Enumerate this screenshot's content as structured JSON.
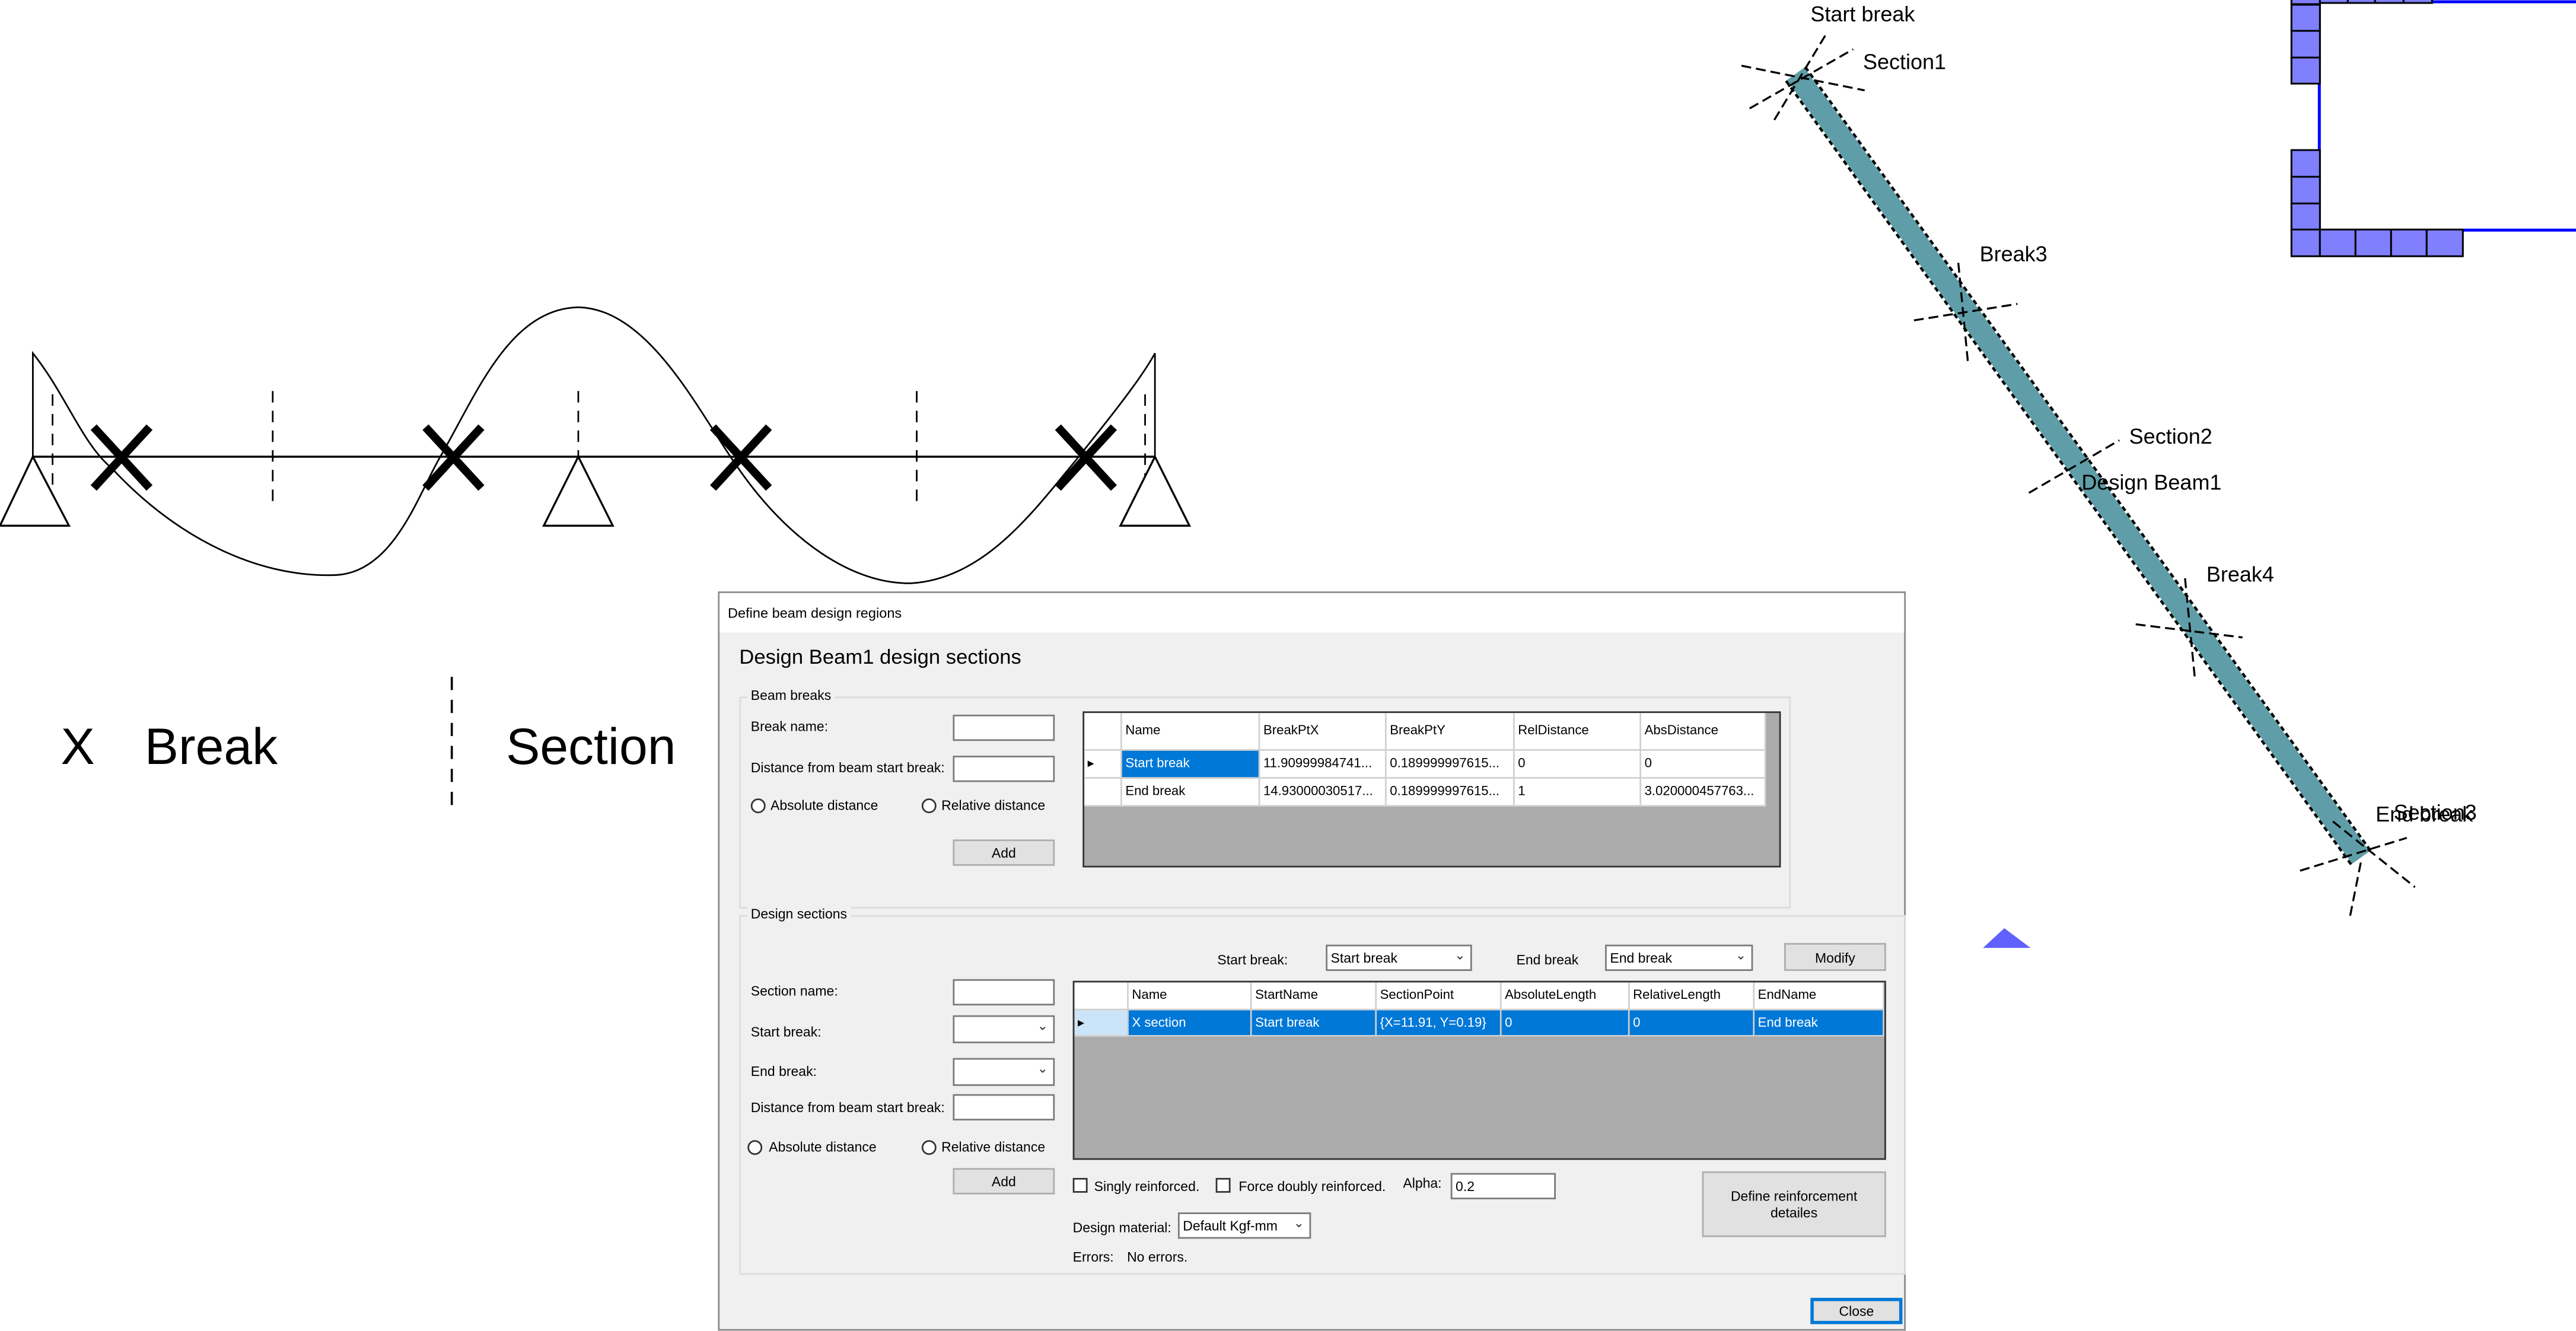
{
  "left_diagram": {
    "legend": {
      "break_symbol": "X",
      "break_label": "Break",
      "section_label": "Section"
    }
  },
  "plan_view": {
    "labels": {
      "start_break": "Start break",
      "section1": "Section1",
      "break3": "Break3",
      "section2": "Section2",
      "beam_name": "Design Beam1",
      "break4": "Break4",
      "end_break": "End break",
      "section3": "Section3"
    },
    "colors": {
      "beam": "#5f9ea8",
      "wall": "#0000ff",
      "wall_block": "#8080ff"
    }
  },
  "dialog": {
    "title": "Define beam design regions",
    "heading": "Design Beam1 design sections",
    "beam_breaks": {
      "group_label": "Beam breaks",
      "break_name_label": "Break name:",
      "break_name_value": "",
      "distance_label": "Distance from beam start break:",
      "distance_value": "",
      "absolute_label": "Absolute distance",
      "relative_label": "Relative distance",
      "add_label": "Add",
      "columns": [
        "Name",
        "BreakPtX",
        "BreakPtY",
        "RelDistance",
        "AbsDistance"
      ],
      "rows": [
        [
          "Start break",
          "11.90999984741...",
          "0.189999997615...",
          "0",
          "0"
        ],
        [
          "End break",
          "14.93000030517...",
          "0.189999997615...",
          "1",
          "3.020000457763..."
        ]
      ]
    },
    "design_sections": {
      "group_label": "Design sections",
      "start_break_label": "Start break:",
      "start_break_value": "Start break",
      "end_break_label": "End break",
      "end_break_value": "End break",
      "modify_label": "Modify",
      "section_name_label": "Section name:",
      "section_name_value": "",
      "start_break_field_label": "Start break:",
      "end_break_field_label": "End break:",
      "distance_label": "Distance from beam start break:",
      "absolute_label": "Absolute distance",
      "relative_label": "Relative distance",
      "add_label": "Add",
      "columns": [
        "Name",
        "StartName",
        "SectionPoint",
        "AbsoluteLength",
        "RelativeLength",
        "EndName"
      ],
      "rows": [
        [
          "X section",
          "Start break",
          "{X=11.91, Y=0.19}",
          "0",
          "0",
          "End break"
        ]
      ],
      "singly_label": "Singly reinforced.",
      "singly_checked": false,
      "force_doubly_label": "Force doubly reinforced.",
      "force_doubly_checked": false,
      "alpha_label": "Alpha:",
      "alpha_value": "0.2",
      "define_reinforcement_label": "Define reinforcement detailes",
      "design_material_label": "Design material:",
      "design_material_value": "Default Kgf-mm",
      "errors_label": "Errors:",
      "errors_value": "No errors."
    },
    "close_label": "Close",
    "colors": {
      "selection": "#0078d7"
    }
  }
}
